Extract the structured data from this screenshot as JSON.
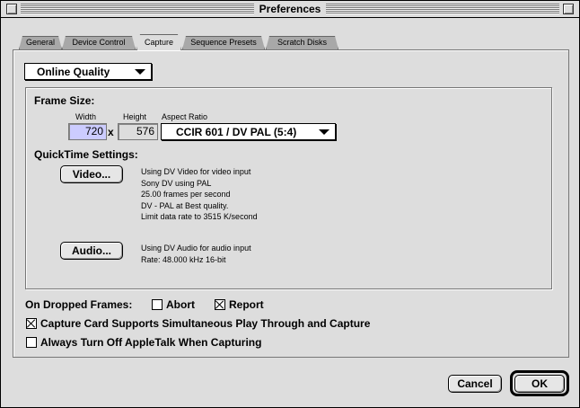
{
  "window": {
    "title": "Preferences"
  },
  "tabs": [
    {
      "label": "General",
      "active": false
    },
    {
      "label": "Device Control",
      "active": false
    },
    {
      "label": "Capture",
      "active": true
    },
    {
      "label": "Sequence Presets",
      "active": false
    },
    {
      "label": "Scratch Disks",
      "active": false
    }
  ],
  "capture": {
    "quality_popup": "Online Quality",
    "frame_size": {
      "heading": "Frame Size:",
      "width_label": "Width",
      "height_label": "Height",
      "aspect_label": "Aspect Ratio",
      "width_value": "720",
      "times": "x",
      "height_value": "576",
      "aspect_value": "CCIR 601 / DV PAL (5:4)"
    },
    "quicktime": {
      "heading": "QuickTime Settings:",
      "video_button": "Video...",
      "video_info": [
        "Using DV Video for video input",
        "Sony DV using PAL",
        "25.00 frames per second",
        "DV - PAL at Best quality.",
        "Limit data rate to 3515 K/second"
      ],
      "audio_button": "Audio...",
      "audio_info": [
        "Using DV Audio for audio input",
        "Rate: 48.000 kHz 16-bit"
      ]
    },
    "dropped_frames": {
      "label": "On Dropped Frames:",
      "abort_label": "Abort",
      "abort_checked": false,
      "report_label": "Report",
      "report_checked": true
    },
    "play_through": {
      "label": "Capture Card Supports Simultaneous Play Through and Capture",
      "checked": true
    },
    "appletalk": {
      "label": "Always Turn Off AppleTalk When Capturing",
      "checked": false
    }
  },
  "buttons": {
    "cancel": "Cancel",
    "ok": "OK"
  },
  "colors": {
    "window_bg": "#dddddd",
    "field_highlight": "#ccccff"
  }
}
